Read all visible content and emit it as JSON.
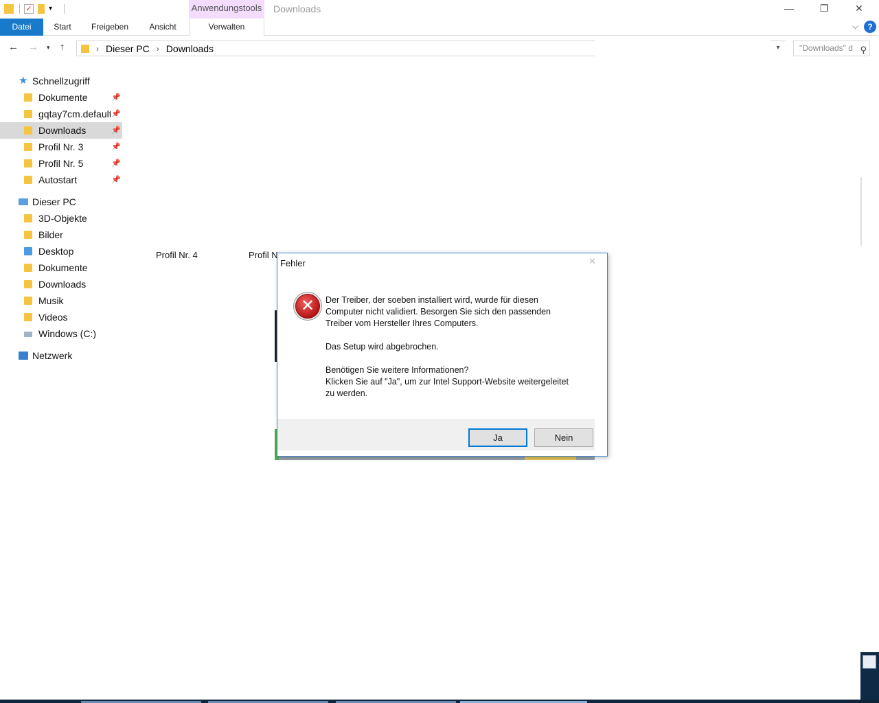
{
  "window": {
    "title": "Downloads",
    "contextual_tab_group": "Anwendungstools",
    "controls": {
      "minimize": "—",
      "restore": "❐",
      "close": "✕"
    }
  },
  "ribbon": {
    "tabs": [
      "Datei",
      "Start",
      "Freigeben",
      "Ansicht"
    ],
    "contextual_tab": "Verwalten",
    "help": "?"
  },
  "address_bar": {
    "breadcrumbs": [
      "Dieser PC",
      "Downloads"
    ],
    "search_placeholder": "\"Downloads\" d"
  },
  "nav_pane": {
    "quick_access": {
      "label": "Schnellzugriff",
      "items": [
        {
          "label": "Dokumente",
          "pinned": true
        },
        {
          "label": "gqtay7cm.default",
          "pinned": true
        },
        {
          "label": "Downloads",
          "pinned": true,
          "selected": true
        },
        {
          "label": "Profil Nr. 3",
          "pinned": true
        },
        {
          "label": "Profil Nr. 5",
          "pinned": true
        },
        {
          "label": "Autostart",
          "pinned": true
        }
      ]
    },
    "this_pc": {
      "label": "Dieser PC",
      "items": [
        "3D-Objekte",
        "Bilder",
        "Desktop",
        "Dokumente",
        "Downloads",
        "Musik",
        "Videos",
        "Windows (C:)"
      ]
    },
    "network": {
      "label": "Netzwerk"
    }
  },
  "background": {
    "partial_labels": [
      "Profil Nr. 4",
      "Profil N"
    ]
  },
  "dialog": {
    "title": "Fehler",
    "close": "✕",
    "message": [
      "Der Treiber, der soeben installiert wird, wurde für diesen\nComputer nicht validiert. Besorgen Sie sich den passenden\nTreiber vom Hersteller Ihres Computers.",
      "Das Setup wird abgebrochen.",
      "Benötigen Sie weitere Informationen?\nKlicken Sie auf \"Ja\", um zur Intel Support-Website weitergeleitet\nzu werden."
    ],
    "buttons": {
      "yes": "Ja",
      "no": "Nein"
    },
    "icon": "error-icon"
  },
  "colors": {
    "file_tab": "#1979ca",
    "contextual_tab": "#f4dcff",
    "selection": "#d9d9d9",
    "dialog_border": "#3b84d8"
  }
}
